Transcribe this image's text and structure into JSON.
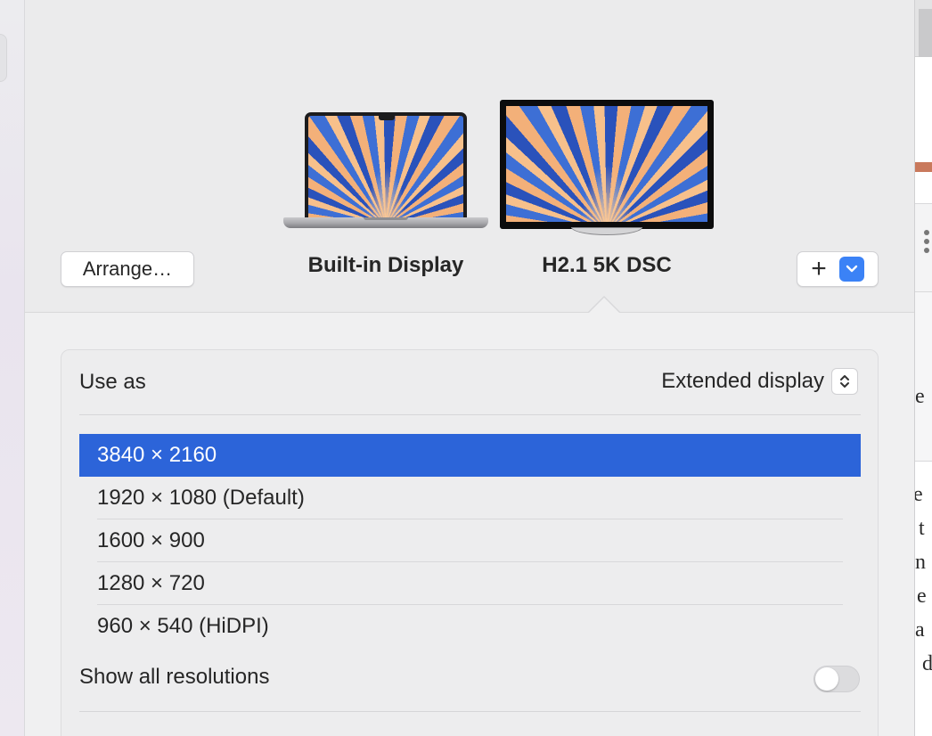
{
  "displays": {
    "arrange_label": "Arrange…",
    "builtin_name": "Built-in Display",
    "external_name": "H2.1 5K DSC",
    "add_label": "+",
    "add_menu_icon": "chevron-down-icon"
  },
  "settings": {
    "use_as_label": "Use as",
    "use_as_value": "Extended display",
    "resolutions": [
      {
        "label": "3840 × 2160",
        "selected": true
      },
      {
        "label": "1920 × 1080 (Default)",
        "selected": false
      },
      {
        "label": "1600 × 900",
        "selected": false
      },
      {
        "label": "1280 × 720",
        "selected": false
      },
      {
        "label": "960 × 540 (HiDPI)",
        "selected": false
      }
    ],
    "show_all_label": "Show all resolutions",
    "show_all_enabled": false
  },
  "background_window": {
    "fragments": [
      "e",
      "e",
      "t",
      "n",
      "e",
      "a",
      "d"
    ]
  },
  "colors": {
    "accent": "#2c64d9",
    "menu_button": "#3b82f6",
    "background_stripe": "#c9795c"
  }
}
